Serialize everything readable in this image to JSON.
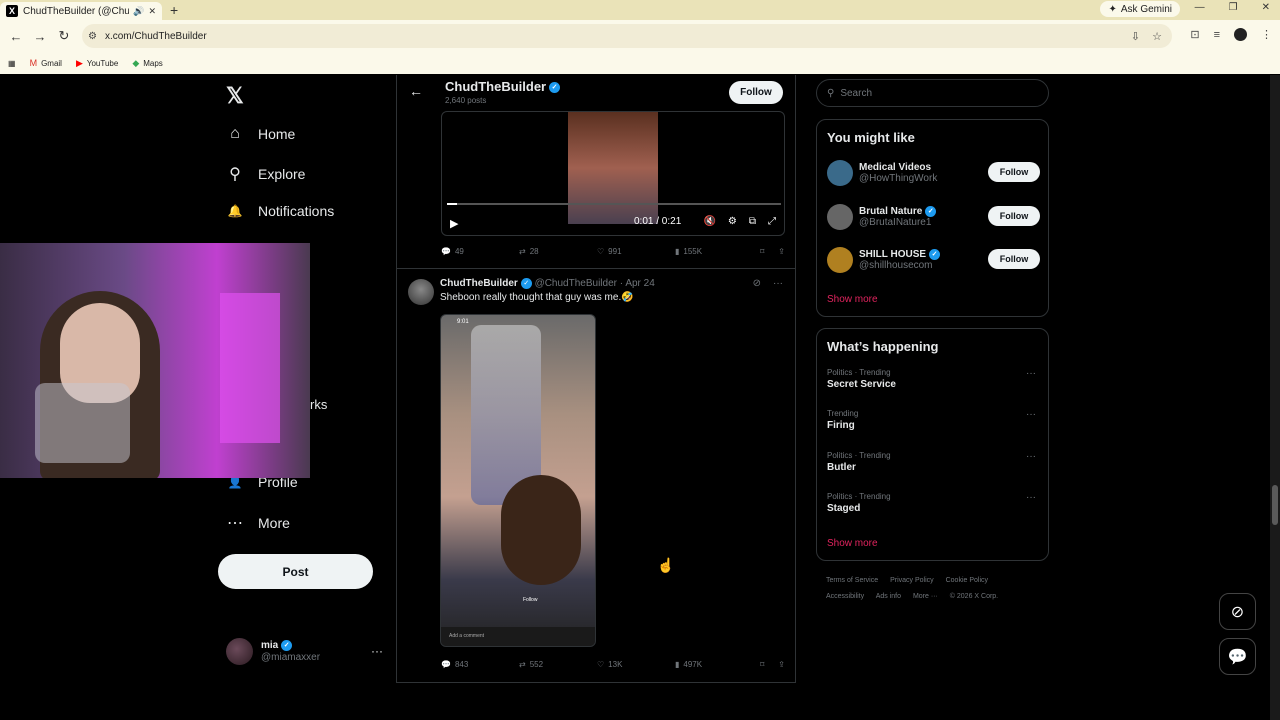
{
  "browser": {
    "tab_title": "ChudTheBuilder (@ChudTh",
    "new_tab": "+",
    "ask_gemini": "Ask Gemini",
    "url": "x.com/ChudTheBuilder",
    "bookmarks": [
      {
        "icon": "gmail-icon",
        "glyph": "M",
        "label": "Gmail"
      },
      {
        "icon": "youtube-icon",
        "glyph": "▶",
        "label": "YouTube"
      },
      {
        "icon": "maps-icon",
        "glyph": "◆",
        "label": "Maps"
      }
    ]
  },
  "nav": {
    "logo": "𝕏",
    "items": [
      {
        "label": "Home",
        "glyph": "⌂",
        "icon": "home-icon"
      },
      {
        "label": "Explore",
        "glyph": "⚲",
        "icon": "search-icon"
      },
      {
        "label": "Notifications",
        "glyph": "🔔",
        "icon": "bell-icon"
      },
      {
        "label": "Profile",
        "glyph": "👤",
        "icon": "profile-icon"
      },
      {
        "label": "More",
        "glyph": "⋯",
        "icon": "more-icon"
      }
    ],
    "covered_fragment": "rks",
    "post_label": "Post"
  },
  "me": {
    "name": "mia",
    "handle": "@miamaxxer",
    "more": "···"
  },
  "profile_header": {
    "name": "ChudTheBuilder",
    "posts": "2,640 posts",
    "follow": "Follow"
  },
  "tweet1": {
    "time": "0:01 / 0:21",
    "replies": "49",
    "reposts": "28",
    "likes": "991",
    "views": "155K"
  },
  "tweet2": {
    "name": "ChudTheBuilder",
    "handle": "@ChudTheBuilder",
    "date": "· Apr 24",
    "text": "Sheboon really thought that guy was me.🤣",
    "video_status": "9:01",
    "video_follow": "Follow",
    "video_comment": "Add a comment",
    "replies": "843",
    "reposts": "552",
    "likes": "13K",
    "views": "497K"
  },
  "search": {
    "placeholder": "Search"
  },
  "you_might_like": {
    "title": "You might like",
    "accounts": [
      {
        "name": "Medical Videos",
        "handle": "@HowThingWork",
        "follow": "Follow",
        "verified": false,
        "color": "#3a6a8a"
      },
      {
        "name": "Brutal Nature",
        "handle": "@BrutaINature1",
        "follow": "Follow",
        "verified": true,
        "color": "#666666"
      },
      {
        "name": "SHILL HOUSE",
        "handle": "@shillhousecom",
        "follow": "Follow",
        "verified": true,
        "color": "#b08020"
      }
    ],
    "show_more": "Show more"
  },
  "whats_happening": {
    "title": "What’s happening",
    "trends": [
      {
        "context": "Politics · Trending",
        "topic": "Secret Service"
      },
      {
        "context": "Trending",
        "topic": "Firing"
      },
      {
        "context": "Politics · Trending",
        "topic": "Butler"
      },
      {
        "context": "Politics · Trending",
        "topic": "Staged"
      }
    ],
    "show_more": "Show more"
  },
  "footer": [
    "Terms of Service",
    "Privacy Policy",
    "Cookie Policy",
    "Accessibility",
    "Ads info",
    "More ···",
    "© 2026 X Corp."
  ]
}
